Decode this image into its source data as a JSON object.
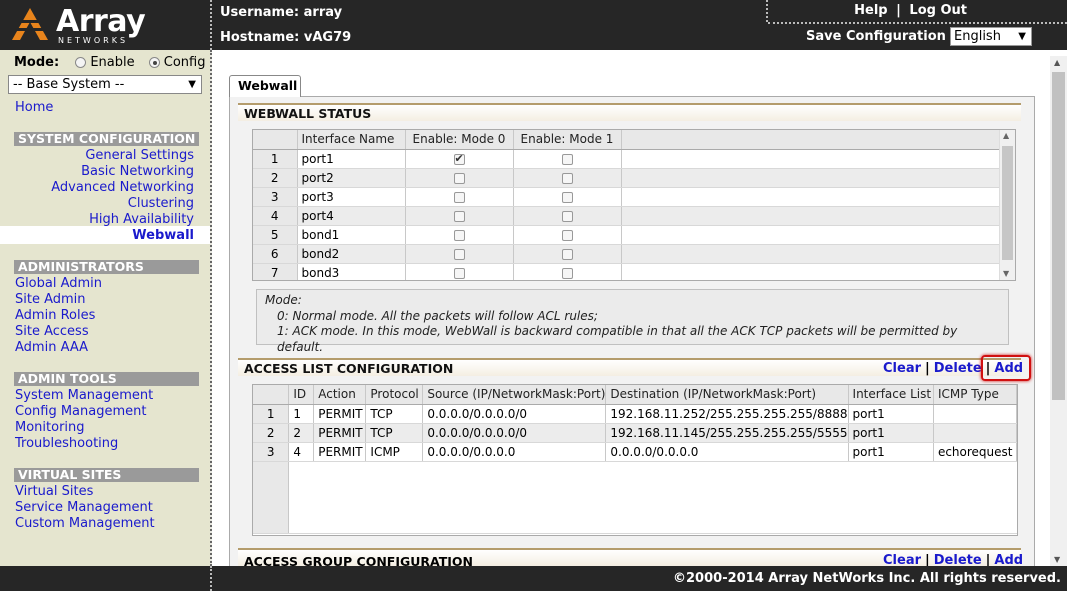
{
  "brand": {
    "name": "Array",
    "sub": "NETWORKS"
  },
  "header": {
    "username_label": "Username: array",
    "hostname_label": "Hostname: vAG79",
    "help": "Help",
    "logout": "Log Out",
    "save": "Save Configuration",
    "language": "English"
  },
  "sidebar": {
    "mode_label": "Mode:",
    "mode_enable": "Enable",
    "mode_config": "Config",
    "system_select": "-- Base System --",
    "home": "Home",
    "sys_head": "SYSTEM CONFIGURATION",
    "sys_items": [
      "General Settings",
      "Basic Networking",
      "Advanced Networking",
      "Clustering",
      "High Availability",
      "Webwall"
    ],
    "admin_head": "ADMINISTRATORS",
    "admin_items": [
      "Global Admin",
      "Site Admin",
      "Admin Roles",
      "Site Access",
      "Admin AAA"
    ],
    "tools_head": "ADMIN TOOLS",
    "tools_items": [
      "System Management",
      "Config Management",
      "Monitoring",
      "Troubleshooting"
    ],
    "vs_head": "VIRTUAL SITES",
    "vs_items": [
      "Virtual Sites",
      "Service Management",
      "Custom Management"
    ]
  },
  "main": {
    "tab": "Webwall",
    "status": {
      "title": "WEBWALL STATUS",
      "columns": [
        "Interface Name",
        "Enable: Mode 0",
        "Enable: Mode 1"
      ],
      "rows": [
        {
          "n": "1",
          "name": "port1",
          "m0": true,
          "m1": false
        },
        {
          "n": "2",
          "name": "port2",
          "m0": false,
          "m1": false
        },
        {
          "n": "3",
          "name": "port3",
          "m0": false,
          "m1": false
        },
        {
          "n": "4",
          "name": "port4",
          "m0": false,
          "m1": false
        },
        {
          "n": "5",
          "name": "bond1",
          "m0": false,
          "m1": false
        },
        {
          "n": "6",
          "name": "bond2",
          "m0": false,
          "m1": false
        },
        {
          "n": "7",
          "name": "bond3",
          "m0": false,
          "m1": false
        }
      ]
    },
    "mode_note": {
      "l1": "Mode:",
      "l2": "0: Normal mode. All the packets will follow ACL rules;",
      "l3": "1: ACK mode. In this mode, WebWall is backward compatible in that all the ACK TCP packets will be permitted by default."
    },
    "acl": {
      "title": "ACCESS LIST CONFIGURATION",
      "clear": "Clear",
      "delete": "Delete",
      "add": "Add",
      "columns": [
        "ID",
        "Action",
        "Protocol",
        "Source (IP/NetworkMask:Port)",
        "Destination (IP/NetworkMask:Port)",
        "Interface List",
        "ICMP Type"
      ],
      "rows": [
        {
          "n": "1",
          "id": "1",
          "action": "PERMIT",
          "proto": "TCP",
          "src": "0.0.0.0/0.0.0.0/0",
          "dst": "192.168.11.252/255.255.255.255/8888",
          "iface": "port1",
          "icmp": ""
        },
        {
          "n": "2",
          "id": "2",
          "action": "PERMIT",
          "proto": "TCP",
          "src": "0.0.0.0/0.0.0.0/0",
          "dst": "192.168.11.145/255.255.255.255/5555",
          "iface": "port1",
          "icmp": ""
        },
        {
          "n": "3",
          "id": "4",
          "action": "PERMIT",
          "proto": "ICMP",
          "src": "0.0.0.0/0.0.0.0",
          "dst": "0.0.0.0/0.0.0.0",
          "iface": "port1",
          "icmp": "echorequest"
        }
      ]
    },
    "group": {
      "title": "ACCESS GROUP CONFIGURATION",
      "clear": "Clear",
      "delete": "Delete",
      "add": "Add"
    }
  },
  "footer": {
    "copyright": "©2000-2014 Array NetWorks Inc. All rights reserved."
  }
}
